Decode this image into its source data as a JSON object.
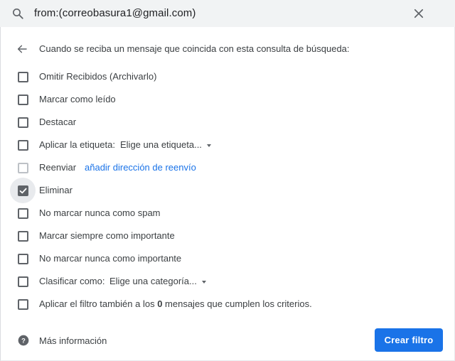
{
  "search": {
    "query": "from:(correobasura1@gmail.com)"
  },
  "header": {
    "text": "Cuando se reciba un mensaje que coincida con esta consulta de búsqueda:"
  },
  "options": [
    {
      "label": "Omitir Recibidos (Archivarlo)",
      "checked": false
    },
    {
      "label": "Marcar como leído",
      "checked": false
    },
    {
      "label": "Destacar",
      "checked": false
    },
    {
      "label": "Aplicar la etiqueta:",
      "checked": false,
      "select": "Elige una etiqueta..."
    },
    {
      "label": "Reenviar",
      "checked": false,
      "disabled": true,
      "link": "añadir dirección de reenvío"
    },
    {
      "label": "Eliminar",
      "checked": true
    },
    {
      "label": "No marcar nunca como spam",
      "checked": false
    },
    {
      "label": "Marcar siempre como importante",
      "checked": false
    },
    {
      "label": "No marcar nunca como importante",
      "checked": false
    },
    {
      "label": "Clasificar como:",
      "checked": false,
      "select": "Elige una categoría..."
    },
    {
      "label_before": "Aplicar el filtro también a los ",
      "count": "0",
      "label_after": " mensajes que cumplen los criterios.",
      "checked": false
    }
  ],
  "footer": {
    "help_text": "Más información",
    "create_button": "Crear filtro"
  },
  "colors": {
    "accent": "#1a73e8",
    "checkbox": "#5f6368"
  },
  "icons": {
    "search": "search-icon",
    "close": "close-icon",
    "back": "arrow-back-icon",
    "help": "help-circle-icon"
  }
}
